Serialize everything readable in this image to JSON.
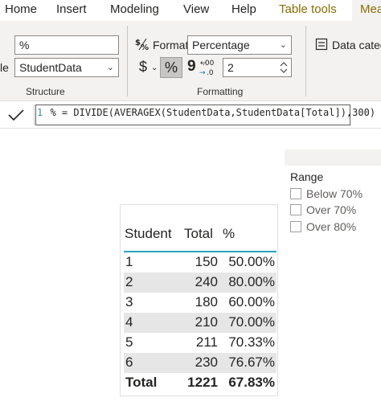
{
  "ribbon": {
    "tabs": [
      "Home",
      "Insert",
      "Modeling",
      "View",
      "Help",
      "Table tools",
      "Mea"
    ],
    "structure": {
      "name_value": "%",
      "table_label_cut": "le",
      "table_value": "StudentData",
      "group_label": "Structure"
    },
    "formatting": {
      "format_label": "Format",
      "format_value": "Percentage",
      "currency_symbol": "$",
      "percent_symbol": "%",
      "comma_symbol": "9",
      "decimals_value": "2",
      "group_label": "Formatting"
    },
    "properties": {
      "data_category_label": "Data catego"
    }
  },
  "formula_bar": {
    "line_number": "1",
    "formula": "% = DIVIDE(AVERAGEX(StudentData,StudentData[Total]),300)"
  },
  "slicer": {
    "title": "Range",
    "options": [
      "Below 70%",
      "Over 70%",
      "Over 80%"
    ]
  },
  "table": {
    "columns": [
      "Student",
      "Total",
      "%"
    ],
    "rows": [
      [
        "1",
        "150",
        "50.00%"
      ],
      [
        "2",
        "240",
        "80.00%"
      ],
      [
        "3",
        "180",
        "60.00%"
      ],
      [
        "4",
        "210",
        "70.00%"
      ],
      [
        "5",
        "211",
        "70.33%"
      ],
      [
        "6",
        "230",
        "76.67%"
      ]
    ],
    "total": [
      "Total",
      "1221",
      "67.83%"
    ]
  },
  "colors": {
    "context_tab": "#8a6d00",
    "header_accent": "#2aa1c2",
    "ribbon_bg": "#f3f2f1"
  }
}
